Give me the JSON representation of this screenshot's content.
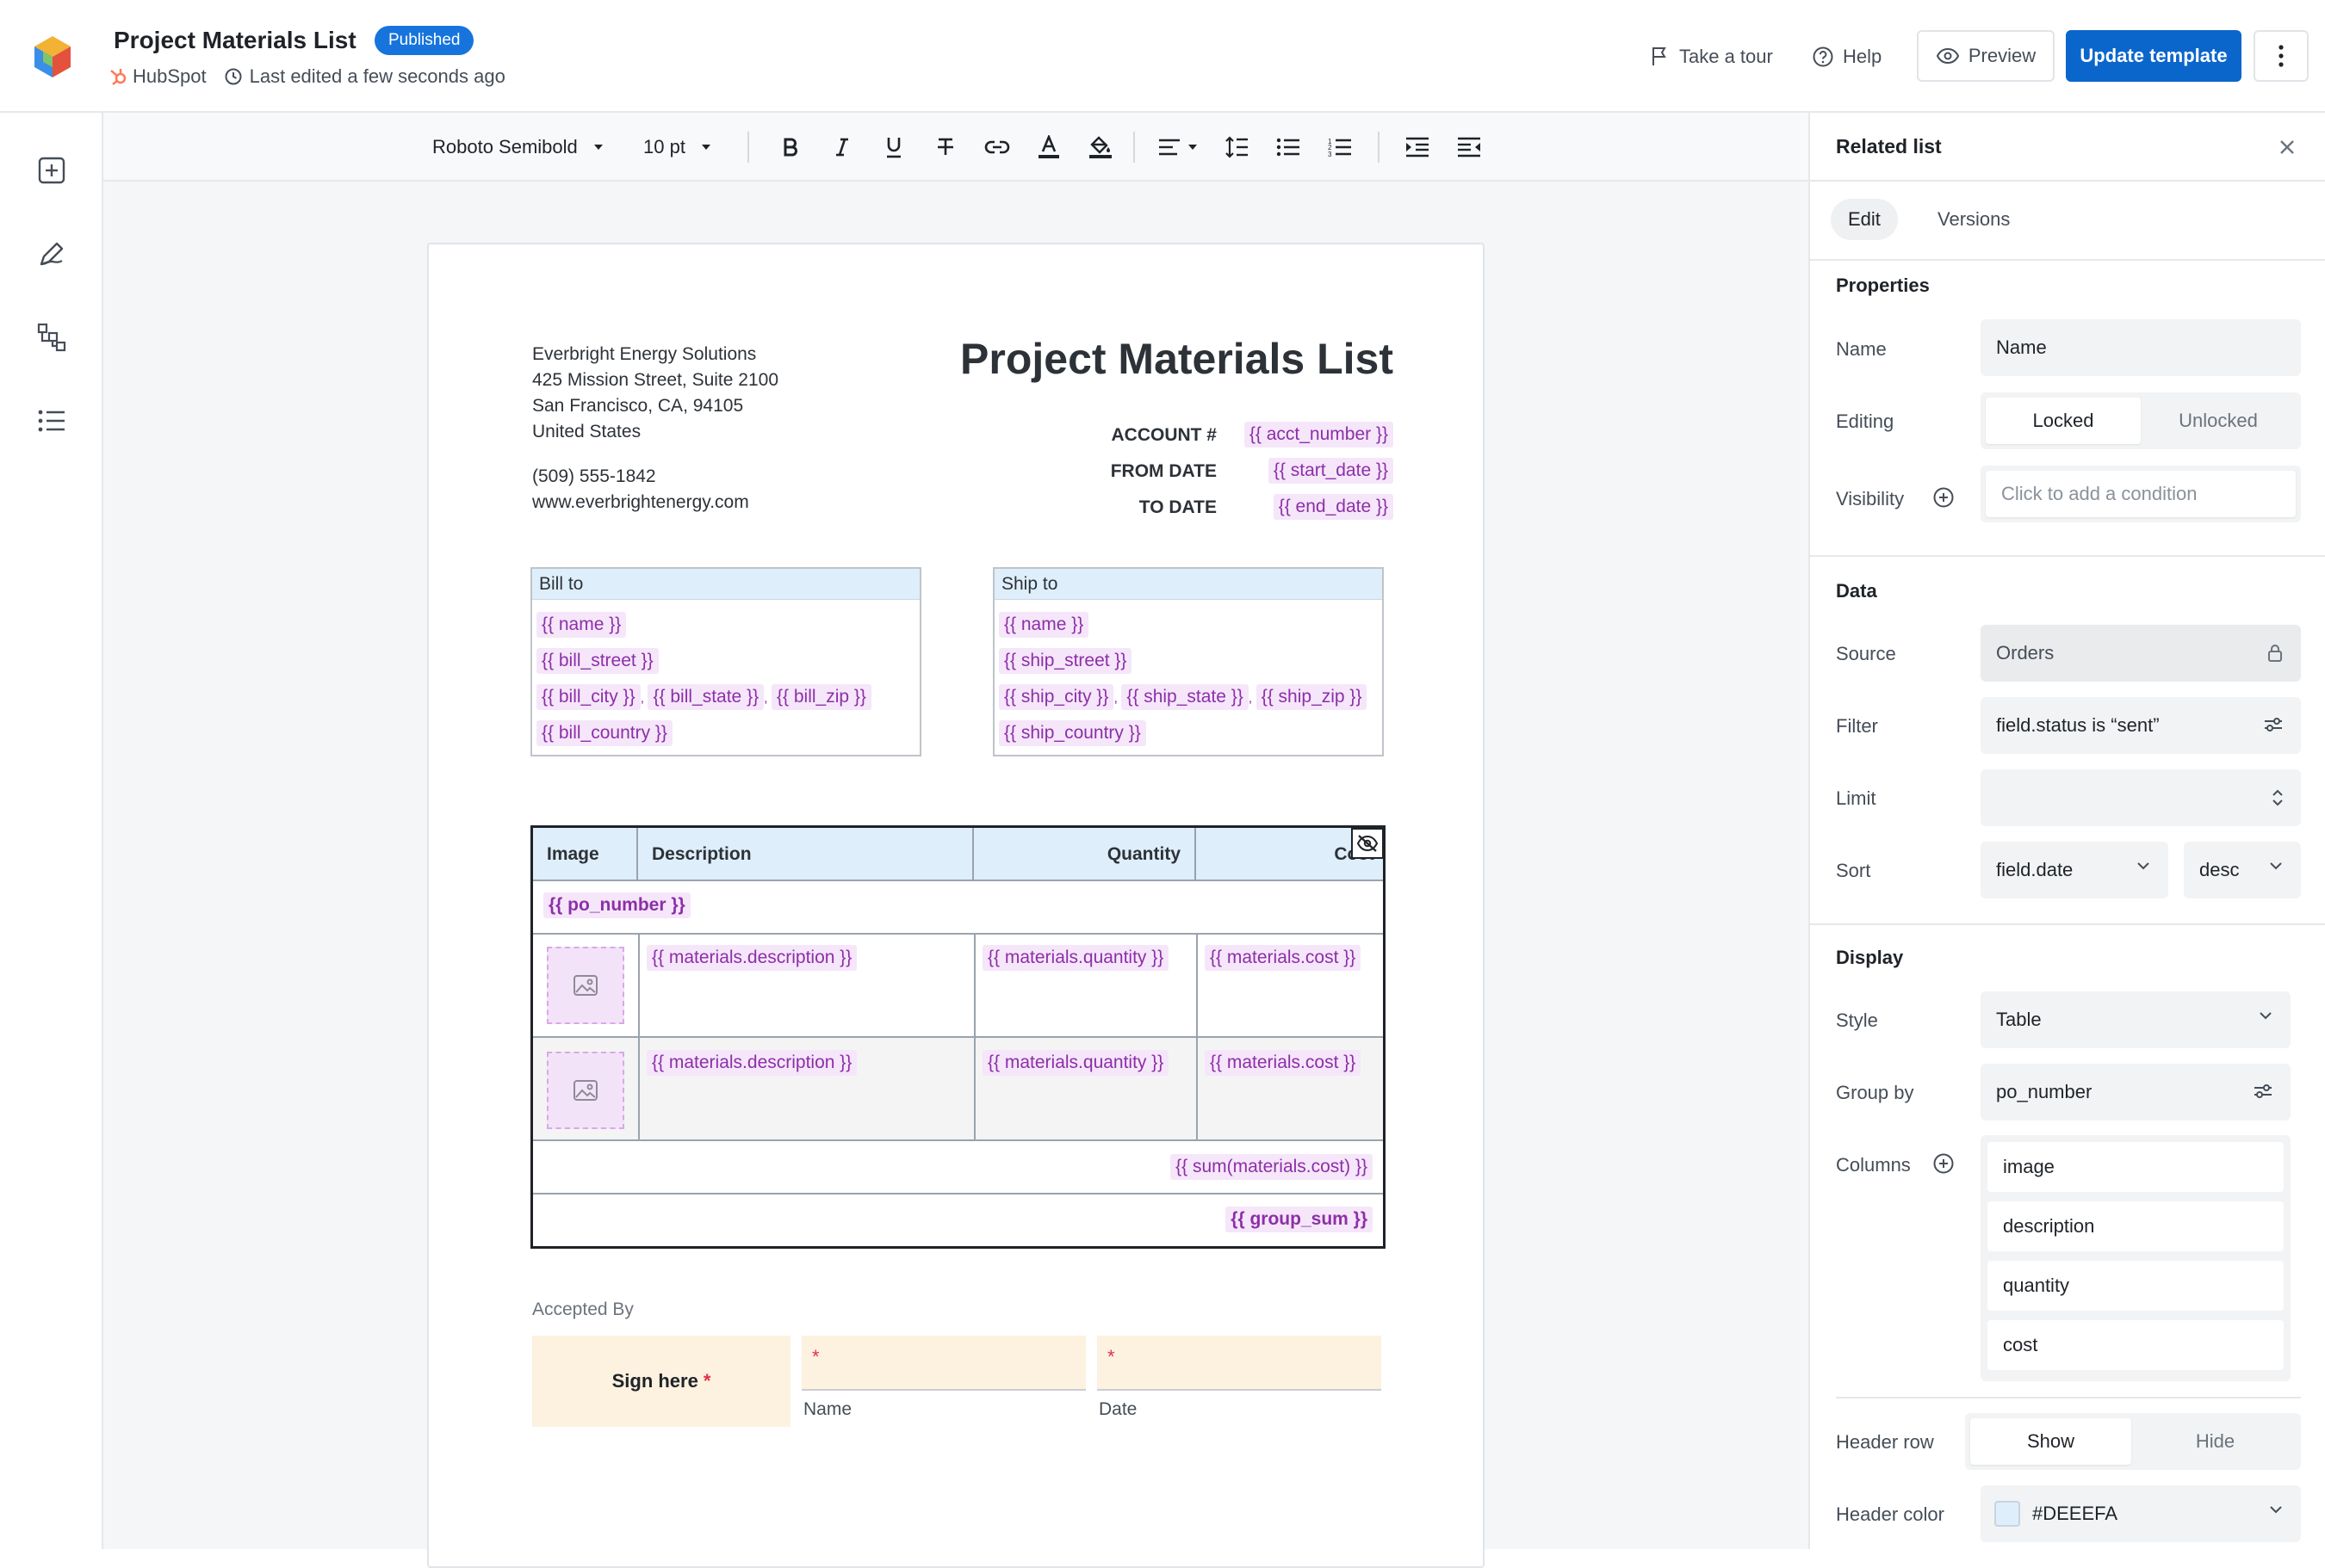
{
  "app": {
    "title": "Project Materials List",
    "status_badge": "Published",
    "source": "HubSpot",
    "last_edited": "Last edited a few seconds ago"
  },
  "header_actions": {
    "tour": "Take a tour",
    "help": "Help",
    "preview": "Preview",
    "update": "Update template"
  },
  "rail": {
    "icons": [
      "add-block-icon",
      "edit-pen-icon",
      "structure-icon",
      "list-icon"
    ]
  },
  "toolbar": {
    "font_family": "Roboto Semibold",
    "font_size": "10 pt"
  },
  "document": {
    "company": {
      "name": "Everbright Energy Solutions",
      "street": "425 Mission Street, Suite 2100",
      "city_line": "San Francisco, CA, 94105",
      "country": "United States",
      "phone": "(509) 555-1842",
      "website": "www.everbrightenergy.com"
    },
    "title": "Project Materials List",
    "meta": [
      {
        "label": "ACCOUNT #",
        "value": "{{ acct_number }}"
      },
      {
        "label": "FROM DATE",
        "value": "{{ start_date }}"
      },
      {
        "label": "TO DATE",
        "value": "{{ end_date }}"
      }
    ],
    "bill_to": {
      "heading": "Bill to",
      "name": "{{ name }}",
      "street": "{{ bill_street }}",
      "city": "{{ bill_city }}",
      "state": "{{ bill_state }}",
      "zip": "{{ bill_zip }}",
      "country": "{{ bill_country }}"
    },
    "ship_to": {
      "heading": "Ship to",
      "name": "{{ name }}",
      "street": "{{ ship_street }}",
      "city": "{{ ship_city }}",
      "state": "{{ ship_state }}",
      "zip": "{{ ship_zip }}",
      "country": "{{ ship_country }}"
    },
    "table": {
      "headers": [
        "Image",
        "Description",
        "Quantity",
        "Cost"
      ],
      "group_label": "{{ po_number }}",
      "rows": [
        {
          "description": "{{ materials.description }}",
          "quantity": "{{ materials.quantity }}",
          "cost": "{{ materials.cost }}"
        },
        {
          "description": "{{ materials.description }}",
          "quantity": "{{ materials.quantity }}",
          "cost": "{{ materials.cost }}"
        }
      ],
      "subtotal": "{{ sum(materials.cost) }}",
      "group_sum": "{{ group_sum }}"
    },
    "signature": {
      "heading": "Accepted By",
      "sign_label": "Sign here",
      "required_mark": "*",
      "name_label": "Name",
      "date_label": "Date"
    }
  },
  "panel": {
    "title": "Related list",
    "tabs": [
      "Edit",
      "Versions"
    ],
    "properties": {
      "heading": "Properties",
      "name_label": "Name",
      "name_value": "Name",
      "editing_label": "Editing",
      "editing_options": [
        "Locked",
        "Unlocked"
      ],
      "editing_selected": "Locked",
      "visibility_label": "Visibility",
      "visibility_placeholder": "Click to add a condition"
    },
    "data": {
      "heading": "Data",
      "source_label": "Source",
      "source_value": "Orders",
      "filter_label": "Filter",
      "filter_value": "field.status is “sent”",
      "limit_label": "Limit",
      "limit_value": "",
      "sort_label": "Sort",
      "sort_field": "field.date",
      "sort_dir": "desc"
    },
    "display": {
      "heading": "Display",
      "style_label": "Style",
      "style_value": "Table",
      "group_label": "Group by",
      "group_value": "po_number",
      "columns_label": "Columns",
      "columns": [
        "image",
        "description",
        "quantity",
        "cost"
      ],
      "header_row_label": "Header row",
      "header_row_options": [
        "Show",
        "Hide"
      ],
      "header_row_selected": "Show",
      "header_color_label": "Header color",
      "header_color_value": "#DEEEFA"
    }
  },
  "colors": {
    "brand_blue": "#0b66cc",
    "badge_blue": "#1674dc",
    "header_fill": "#DEEEFA",
    "tag_bg": "#f5e6fa",
    "tag_text": "#8d2fa8",
    "sign_fill": "#fdf1df",
    "required": "#e0314c"
  }
}
